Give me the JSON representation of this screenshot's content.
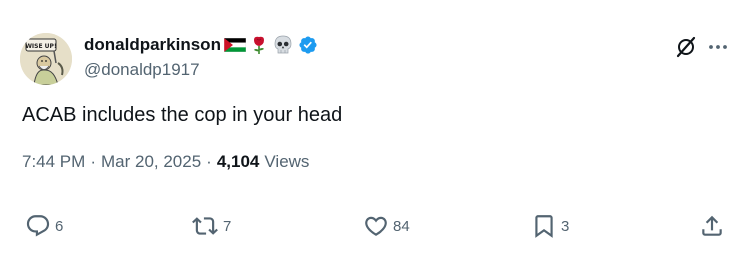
{
  "tweet": {
    "author": {
      "display_name": "donaldparkinson",
      "handle": "@donaldp1917",
      "avatar_sign_text": "WISE UP!",
      "flair_icons": [
        "palestine-flag-icon",
        "rose-icon",
        "skull-icon",
        "verified-badge-icon"
      ]
    },
    "text": "ACAB includes the cop in your head",
    "time": "7:44 PM",
    "date": "Mar 20, 2025",
    "views_count": "4,104",
    "views_label": "Views",
    "separator": "·",
    "actions": {
      "replies": "6",
      "reposts": "7",
      "likes": "84",
      "bookmarks": "3"
    }
  },
  "colors": {
    "text_primary": "#0f1419",
    "text_secondary": "#536471",
    "verified_blue": "#1d9bf0",
    "background": "#ffffff"
  },
  "icons": {
    "grok": "grok-icon",
    "more": "more-dots-icon",
    "reply": "reply-icon",
    "repost": "repost-icon",
    "like": "heart-icon",
    "bookmark": "bookmark-icon",
    "share": "share-icon"
  }
}
